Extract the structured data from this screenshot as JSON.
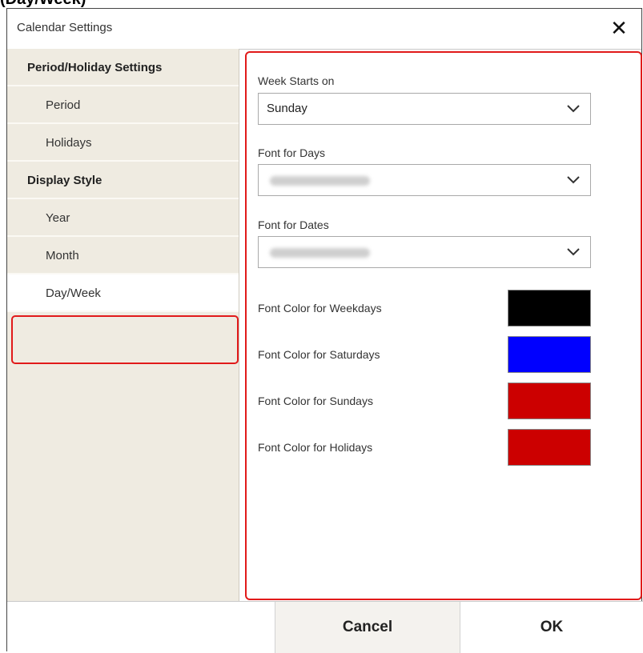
{
  "header_fragment": "(Day/Week)",
  "dialog": {
    "title": "Calendar Settings",
    "close_icon": "close-icon"
  },
  "sidebar": {
    "items": [
      {
        "label": "Period/Holiday Settings",
        "kind": "section"
      },
      {
        "label": "Period",
        "kind": "sub"
      },
      {
        "label": "Holidays",
        "kind": "sub"
      },
      {
        "label": "Display Style",
        "kind": "section"
      },
      {
        "label": "Year",
        "kind": "sub"
      },
      {
        "label": "Month",
        "kind": "sub"
      },
      {
        "label": "Day/Week",
        "kind": "sub",
        "selected": true
      }
    ]
  },
  "settings": {
    "week_starts_on": {
      "label": "Week Starts on",
      "value": "Sunday"
    },
    "font_for_days": {
      "label": "Font for Days"
    },
    "font_for_dates": {
      "label": "Font for Dates"
    },
    "colors": [
      {
        "label": "Font Color for Weekdays",
        "color": "#000000"
      },
      {
        "label": "Font Color for Saturdays",
        "color": "#0000ff"
      },
      {
        "label": "Font Color for Sundays",
        "color": "#cc0000"
      },
      {
        "label": "Font Color for Holidays",
        "color": "#cc0000"
      }
    ]
  },
  "footer": {
    "cancel_label": "Cancel",
    "ok_label": "OK"
  },
  "highlight_color": "#e11a1a"
}
